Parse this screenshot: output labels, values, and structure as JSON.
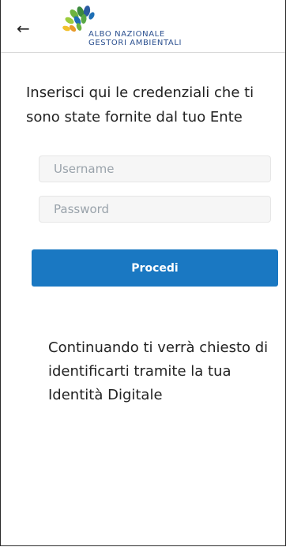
{
  "header": {
    "back_icon": "arrow-left-icon",
    "logo_line1": "ALBO NAZIONALE",
    "logo_line2": "GESTORI AMBIENTALI"
  },
  "main": {
    "intro_text": "Inserisci qui le credenziali che ti sono state fornite dal tuo Ente",
    "username": {
      "placeholder": "Username",
      "value": ""
    },
    "password": {
      "placeholder": "Password",
      "value": ""
    },
    "submit_label": "Procedi",
    "note_text": "Continuando ti verrà chiesto di identificarti tramite la tua Identità Digitale"
  },
  "colors": {
    "primary": "#1a78c2",
    "logo_blue": "#2a4f8f",
    "logo_green": "#6db33f"
  }
}
